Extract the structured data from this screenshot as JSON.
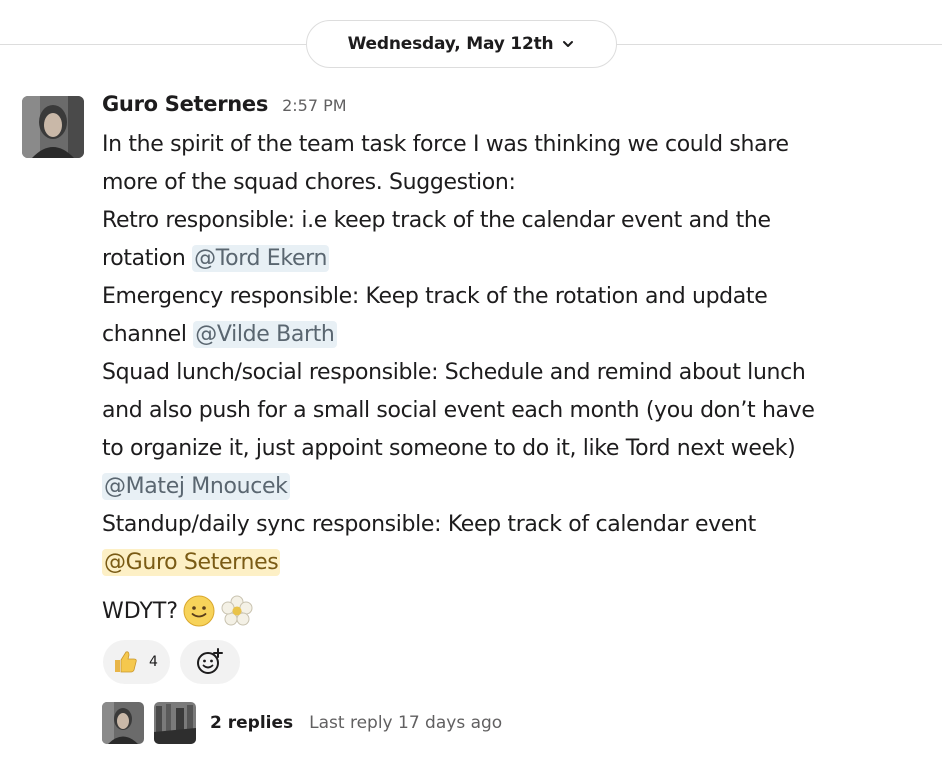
{
  "date_divider": {
    "label": "Wednesday, May 12th",
    "icon": "chevron-down-icon"
  },
  "message": {
    "author": "Guro Seternes",
    "time": "2:57 PM",
    "avatar_icon": "user-avatar",
    "lines": {
      "l1": "In the spirit of the team task force I was thinking we could share",
      "l2": "more of the squad chores. Suggestion:",
      "l3": "Retro responsible: i.e keep track of the calendar event and the",
      "l4": "rotation ",
      "l4_mention": "@Tord Ekern",
      "l5": "Emergency responsible: Keep track of the rotation and update",
      "l6": "channel ",
      "l6_mention": "@Vilde Barth",
      "l7": "Squad lunch/social responsible: Schedule and remind about lunch",
      "l8": "and also push for a small social event each month (you don’t have",
      "l9": "to organize it, just appoint someone to do it, like Tord next week)",
      "l10_mention": "@Matej Mnoucek",
      "l11": "Standup/daily sync responsible: Keep track of calendar event",
      "l12_mention": "@Guro Seternes"
    },
    "closing": "WDYT?",
    "closing_emojis": [
      "slightly-smiling-face-icon",
      "blossom-icon"
    ]
  },
  "reactions": [
    {
      "icon": "thumbs-up-icon",
      "count": "4"
    }
  ],
  "add_reaction_icon": "add-reaction-icon",
  "thread": {
    "replies": "2 replies",
    "last_reply": "Last reply 17 days ago"
  }
}
